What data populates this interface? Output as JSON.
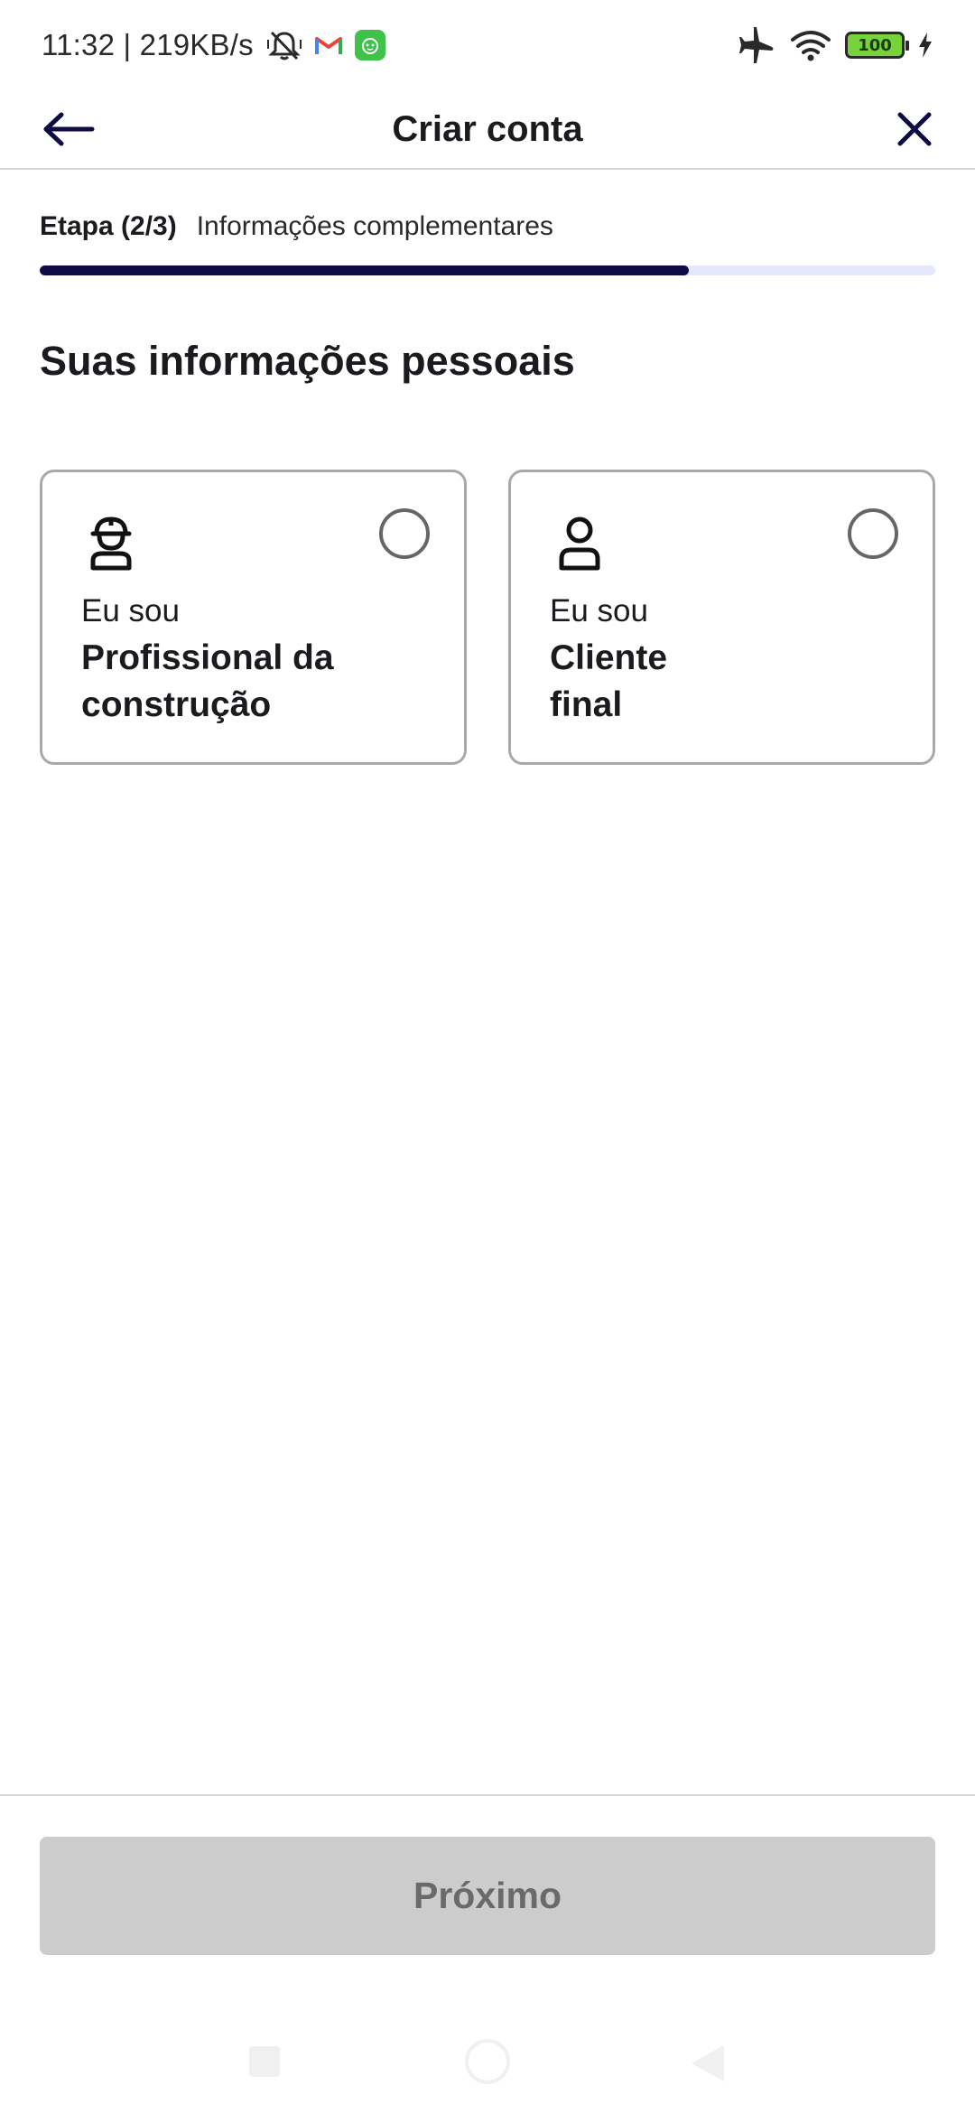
{
  "status_bar": {
    "time_speed": "11:32 | 219KB/s",
    "battery_level": "100",
    "icons": [
      "mute-icon",
      "gmail-icon",
      "app-badge-icon",
      "airplane-icon",
      "wifi-icon",
      "battery-icon",
      "charging-icon"
    ]
  },
  "app_bar": {
    "title": "Criar conta",
    "back_icon": "arrow-left-icon",
    "close_icon": "close-icon"
  },
  "step": {
    "label": "Etapa (2/3)",
    "description": "Informações complementares",
    "progress": 0.725
  },
  "section": {
    "title": "Suas informações pessoais"
  },
  "options": [
    {
      "icon": "construction-worker-icon",
      "small": "Eu sou",
      "line1": "Profissional da",
      "line2": "construção",
      "selected": false
    },
    {
      "icon": "person-icon",
      "small": "Eu sou",
      "line1": "Cliente",
      "line2": "final",
      "selected": false
    }
  ],
  "footer": {
    "next_label": "Próximo",
    "next_enabled": false
  },
  "colors": {
    "primary": "#0f0c45",
    "progress_track": "#e6e7fb",
    "disabled_button": "#cccccc",
    "disabled_text": "#6a6a6a",
    "card_border": "#a9a9a9"
  }
}
